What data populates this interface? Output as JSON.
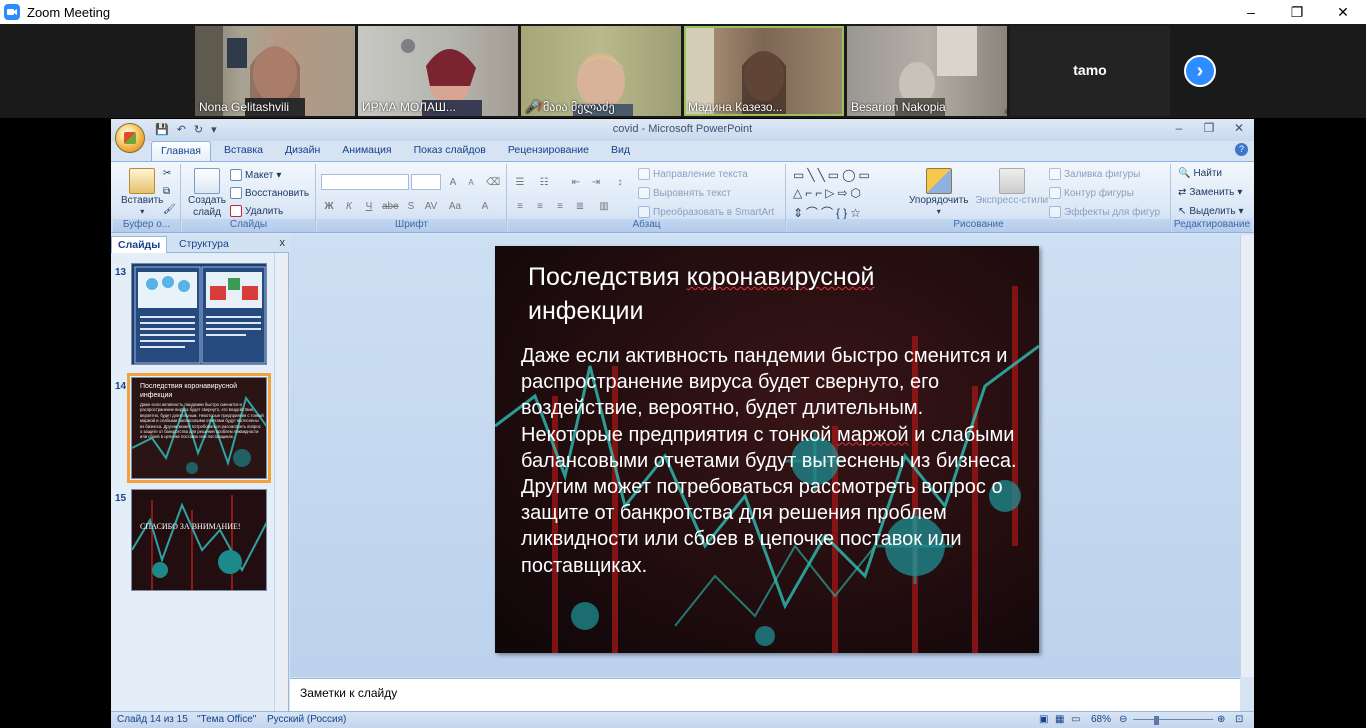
{
  "zoom": {
    "window_title": "Zoom Meeting",
    "win_controls": [
      "–",
      "❐",
      "✕"
    ],
    "participants": [
      {
        "name": "Nona Gelitashvili",
        "muted": false,
        "active": false
      },
      {
        "name": "ИРМА МОЛАШ...",
        "muted": false,
        "active": false
      },
      {
        "name": "მაია მელაძე",
        "muted": true,
        "active": false
      },
      {
        "name": "Мадина Казезо...",
        "muted": false,
        "active": true
      },
      {
        "name": "Besarion Nakopia",
        "muted": true,
        "active": false
      }
    ],
    "no_video_participant": "tamo",
    "next_icon": "chevron-right-icon"
  },
  "ppt": {
    "window_title": "covid - Microsoft PowerPoint",
    "tabs": [
      "Главная",
      "Вставка",
      "Дизайн",
      "Анимация",
      "Показ слайдов",
      "Рецензирование",
      "Вид"
    ],
    "groups": {
      "clipboard": {
        "label": "Буфер о...",
        "paste": "Вставить"
      },
      "slides": {
        "label": "Слайды",
        "create": "Создать",
        "create2": "слайд",
        "layout": "Макет",
        "reset": "Восстановить",
        "delete": "Удалить"
      },
      "font": {
        "label": "Шрифт",
        "bold": "Ж",
        "italic": "К",
        "underline": "Ч",
        "strike": "abe",
        "shadow": "S",
        "spacing": "AV",
        "case": "Aa",
        "color": "A",
        "grow": "A",
        "shrink": "A"
      },
      "paragraph": {
        "label": "Абзац",
        "text_dir": "Направление текста",
        "align_text": "Выровнять текст",
        "smartart": "Преобразовать в SmartArt"
      },
      "drawing": {
        "label": "Рисование",
        "arrange": "Упорядочить",
        "quick_styles": "Экспресс-стили",
        "fill": "Заливка фигуры",
        "outline": "Контур фигуры",
        "effects": "Эффекты для фигур"
      },
      "editing": {
        "label": "Редактирование",
        "find": "Найти",
        "replace": "Заменить",
        "select": "Выделить"
      }
    },
    "left_pane": {
      "tab_slides": "Слайды",
      "tab_outline": "Структура",
      "close": "x",
      "thumbs": [
        {
          "num": "13"
        },
        {
          "num": "14",
          "title": "Последствия коронавирусной инфекции",
          "text": "Даже если активность пандемии быстро сменится и распространение вируса будет свернуто, его воздействие, вероятно, будет длительным. Некоторые предприятия с тонкой маржой и слабыми балансовыми отчетами будут вытеснены из бизнеса. Другим может потребоваться рассмотреть вопрос о защите от банкротства для решения проблем ликвидности или сбоев в цепочке поставок или поставщиках."
        },
        {
          "num": "15",
          "text": "СПАСИБО ЗА ВНИМАНИЕ!"
        }
      ]
    },
    "slide": {
      "title_a": "Последствия ",
      "title_b": "коронавирусной",
      "title_c": "инфекции",
      "body_1": "Даже если активность пандемии быстро сменится и распространение вируса будет свернуто, его воздействие, вероятно, будет длительным. Некоторые предприятия с тонкой ",
      "body_2": "маржой",
      "body_3": " и слабыми балансовыми отчетами будут вытеснены из бизнеса. Другим может потребоваться рассмотреть вопрос о защите от банкротства для решения проблем ликвидности или сбоев в цепочке поставок или поставщиках."
    },
    "notes_placeholder": "Заметки к слайду",
    "status": {
      "slide_count": "Слайд 14 из 15",
      "theme": "\"Тема Office\"",
      "language": "Русский (Россия)",
      "zoom": "68%"
    }
  }
}
